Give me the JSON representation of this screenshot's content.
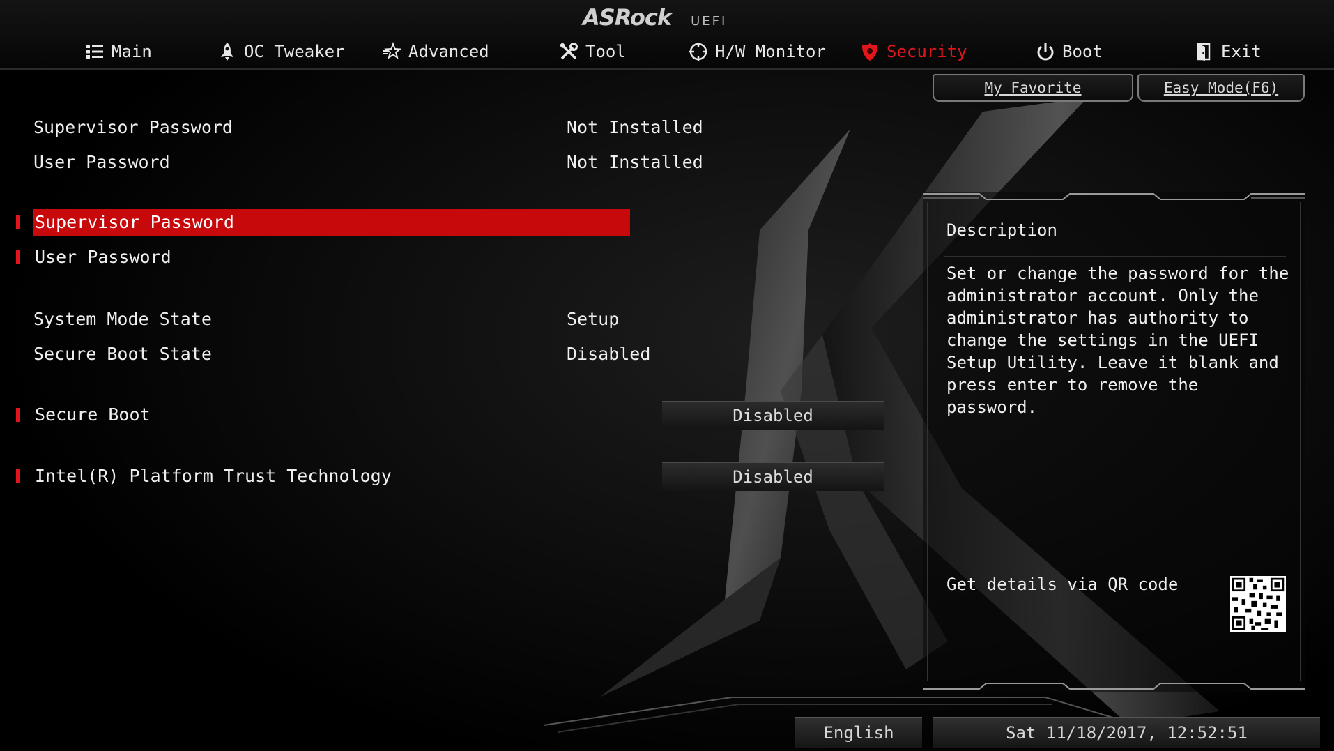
{
  "header": {
    "brand": "ASRock",
    "subtitle": "UEFI"
  },
  "nav": {
    "items": [
      {
        "label": "Main",
        "icon": "list-icon",
        "active": false
      },
      {
        "label": "OC Tweaker",
        "icon": "rocket-icon",
        "active": false
      },
      {
        "label": "Advanced",
        "icon": "star-icon",
        "active": false
      },
      {
        "label": "Tool",
        "icon": "tools-icon",
        "active": false
      },
      {
        "label": "H/W Monitor",
        "icon": "monitor-icon",
        "active": false
      },
      {
        "label": "Security",
        "icon": "shield-icon",
        "active": true
      },
      {
        "label": "Boot",
        "icon": "power-icon",
        "active": false
      },
      {
        "label": "Exit",
        "icon": "exit-door-icon",
        "active": false
      }
    ]
  },
  "toolbar": {
    "favorite_label": "My Favorite",
    "easy_mode_label": "Easy Mode(F6)"
  },
  "settings": {
    "supervisor_status": {
      "label": "Supervisor Password",
      "value": "Not Installed"
    },
    "user_status": {
      "label": "User Password",
      "value": "Not Installed"
    },
    "supervisor_password": {
      "label": "Supervisor Password"
    },
    "user_password": {
      "label": "User Password"
    },
    "system_mode": {
      "label": "System Mode State",
      "value": "Setup"
    },
    "secure_boot_state": {
      "label": "Secure Boot State",
      "value": "Disabled"
    },
    "secure_boot": {
      "label": "Secure Boot",
      "value": "Disabled"
    },
    "ptt": {
      "label": "Intel(R) Platform Trust Technology",
      "value": "Disabled"
    }
  },
  "description": {
    "title": "Description",
    "text": "Set or change the password for the\nadministrator account. Only the\nadministrator has authority to\nchange the settings in the UEFI\nSetup Utility. Leave it blank and\npress enter to remove the password.",
    "qr_label": "Get details via QR code"
  },
  "footer": {
    "language": "English",
    "datetime": "Sat 11/18/2017, 12:52:51"
  },
  "colors": {
    "accent": "#c8090c",
    "active_tab": "#e0161c",
    "background": "#000000"
  }
}
